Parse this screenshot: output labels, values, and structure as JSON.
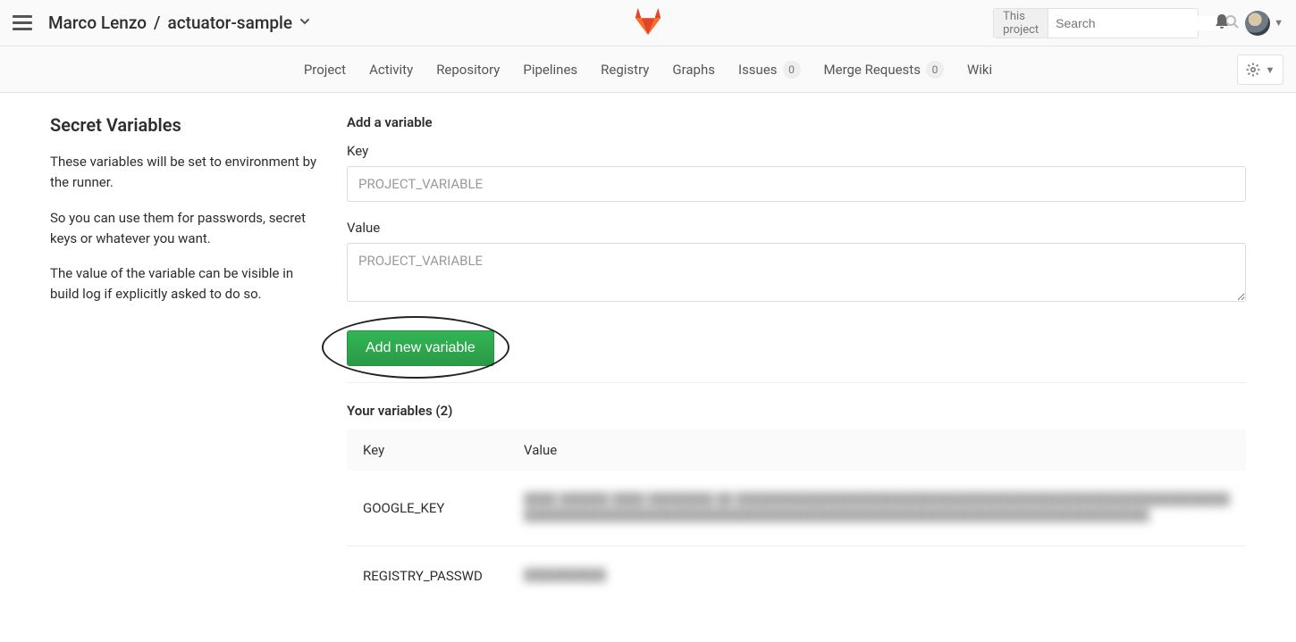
{
  "header": {
    "breadcrumb_owner": "Marco Lenzo",
    "breadcrumb_project": "actuator-sample",
    "search_scope": "This project",
    "search_placeholder": "Search"
  },
  "nav": {
    "items": [
      {
        "label": "Project"
      },
      {
        "label": "Activity"
      },
      {
        "label": "Repository"
      },
      {
        "label": "Pipelines"
      },
      {
        "label": "Registry"
      },
      {
        "label": "Graphs"
      },
      {
        "label": "Issues",
        "count": "0"
      },
      {
        "label": "Merge Requests",
        "count": "0"
      },
      {
        "label": "Wiki"
      }
    ]
  },
  "sidebar": {
    "title": "Secret Variables",
    "p1": "These variables will be set to environment by the runner.",
    "p2": "So you can use them for passwords, secret keys or whatever you want.",
    "p3": "The value of the variable can be visible in build log if explicitly asked to do so."
  },
  "form": {
    "heading": "Add a variable",
    "key_label": "Key",
    "key_placeholder": "PROJECT_VARIABLE",
    "value_label": "Value",
    "value_placeholder": "PROJECT_VARIABLE",
    "submit_label": "Add new variable"
  },
  "variables": {
    "heading": "Your variables (2)",
    "col_key": "Key",
    "col_value": "Value",
    "rows": [
      {
        "key": "GOOGLE_KEY",
        "value_masked": "████ ██████ ████ ████████ ██ ████████████████████████████████████████████████████████████████████████████████████████████████████████████████████████████████████████"
      },
      {
        "key": "REGISTRY_PASSWD",
        "value_masked": "██████████"
      }
    ]
  }
}
